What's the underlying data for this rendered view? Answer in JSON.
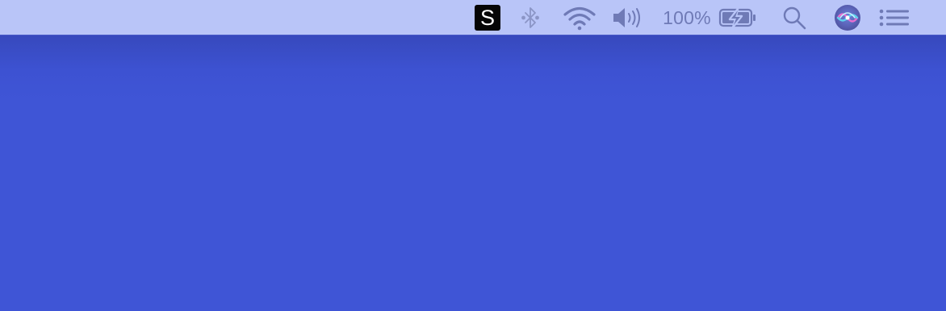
{
  "desktop": {
    "background": "#3f55d6"
  },
  "menubar": {
    "background": "#b9c5f8",
    "icon_color": "#6f7ab6",
    "items": [
      {
        "name": "app-s-icon",
        "label": "S"
      },
      {
        "name": "bluetooth-icon"
      },
      {
        "name": "wifi-icon"
      },
      {
        "name": "volume-icon"
      },
      {
        "name": "battery-percentage",
        "text": "100%"
      },
      {
        "name": "battery-charging-icon"
      },
      {
        "name": "spotlight-search-icon"
      },
      {
        "name": "siri-icon"
      },
      {
        "name": "notification-center-icon"
      }
    ],
    "battery_percent": "100%",
    "app_label": "S"
  }
}
